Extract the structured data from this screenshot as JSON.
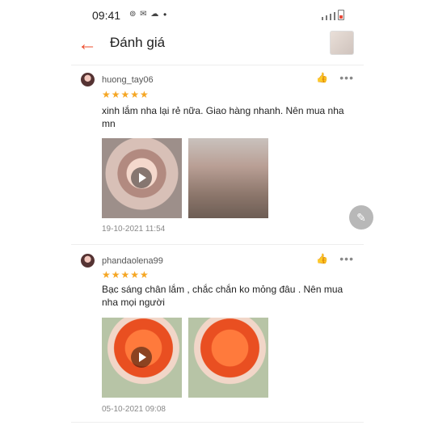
{
  "status": {
    "time": "09:41",
    "icons": "⊚ ✉ ☁",
    "dot": "•"
  },
  "app": {
    "title": "Đánh giá",
    "back_icon": "arrow-left-icon",
    "accent": "#ee4d2d"
  },
  "reviews": [
    {
      "username": "huong_tay06",
      "stars": "★★★★★",
      "text": "xinh lắm nha lại rẻ nữa. Giao hàng nhanh. Nên mua nha mn",
      "date": "19-10-2021 11:54"
    },
    {
      "username": "phandaolena99",
      "stars": "★★★★★",
      "text": "Bạc sáng chân lắm , chắc chắn ko mỏng đâu . Nên mua nha mọi người",
      "date": "05-10-2021 09:08"
    }
  ],
  "icons": {
    "like": "👍",
    "more": "•••",
    "edit": "✎"
  }
}
